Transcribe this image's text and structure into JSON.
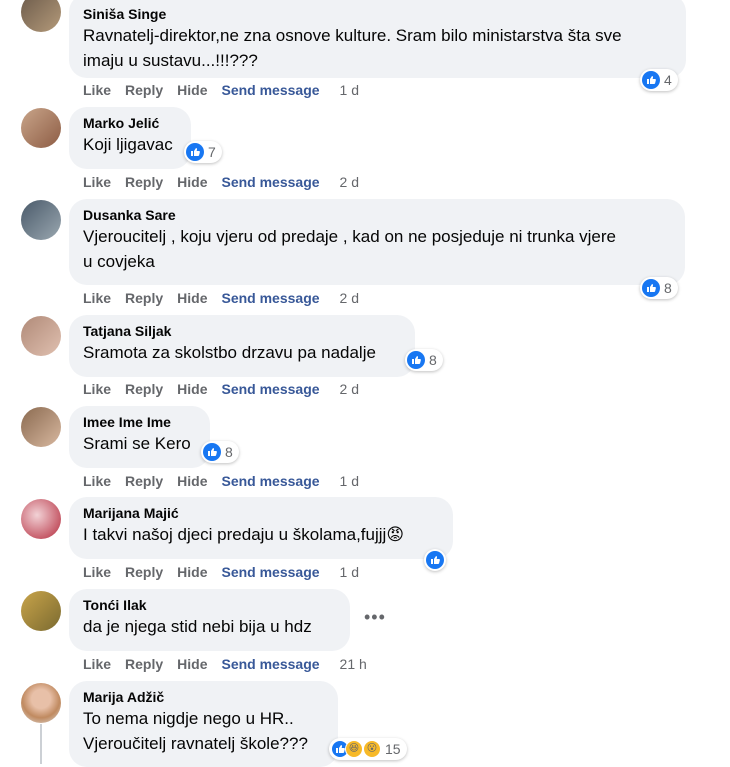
{
  "actions": {
    "like": "Like",
    "reply": "Reply",
    "hide": "Hide",
    "send_message": "Send message"
  },
  "comments": [
    {
      "author": "Siniša Singe",
      "text": "Ravnatelj-direktor,ne zna osnove kulture. Sram bilo ministarstva šta sve\nimaju u sustavu...!!!???",
      "reactions": "4",
      "time": "1 d"
    },
    {
      "author": "Marko Jelić",
      "text": "Koji ljigavac",
      "reactions": "7",
      "time": "2 d"
    },
    {
      "author": "Dusanka Sare",
      "text": "Vjeroucitelj , koju vjeru od predaje , kad on ne posjeduje ni trunka vjere\nu covjeka",
      "reactions": "8",
      "time": "2 d"
    },
    {
      "author": "Tatjana Siljak",
      "text": "Sramota za skolstbo drzavu pa nadalje",
      "reactions": "8",
      "time": "2 d"
    },
    {
      "author": "Imee Ime Ime",
      "text": "Srami se Kero",
      "reactions": "8",
      "time": "1 d"
    },
    {
      "author": "Marijana Majić",
      "text": "I takvi našoj djeci predaju u školama,fujjj😡",
      "reactions": "",
      "time": "1 d"
    },
    {
      "author": "Tonći Ilak",
      "text": "da je njega stid nebi bija u hdz",
      "reactions": "",
      "time": "21 h"
    },
    {
      "author": "Marija Adžič",
      "text": "To nema nigdje nego u HR..\nVjeroučitelj ravnatelj škole???",
      "reactions": "15",
      "time": ""
    }
  ],
  "more_options": "•••",
  "colors": {
    "like_blue": "#1877f2",
    "bubble_bg": "#f0f2f5",
    "link": "#385898",
    "muted": "#65676b"
  },
  "icons": [
    "like-icon",
    "haha-icon",
    "wow-icon",
    "more-options-icon",
    "avatar"
  ]
}
